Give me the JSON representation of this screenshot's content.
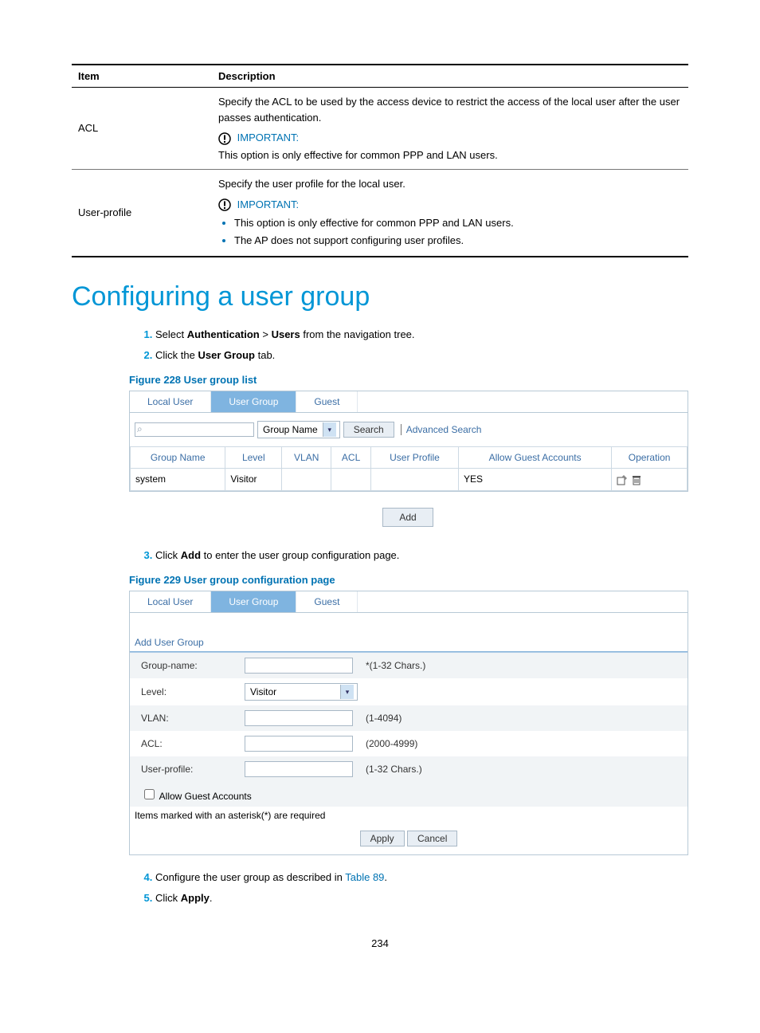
{
  "table": {
    "headers": {
      "item": "Item",
      "desc": "Description"
    },
    "row1": {
      "item": "ACL",
      "line1": "Specify the ACL to be used by the access device to restrict the access of the local user after the user passes authentication.",
      "important": "IMPORTANT:",
      "line2": "This option is only effective for common PPP and LAN users."
    },
    "row2": {
      "item": "User-profile",
      "line1": "Specify the user profile for the local user.",
      "important": "IMPORTANT:",
      "b1": "This option is only effective for common PPP and LAN users.",
      "b2": "The AP does not support configuring user profiles."
    }
  },
  "heading": "Configuring a user group",
  "steps": {
    "s1a": "Select ",
    "s1b": "Authentication",
    "s1c": " > ",
    "s1d": "Users",
    "s1e": " from the navigation tree.",
    "s2a": "Click the ",
    "s2b": "User Group",
    "s2c": " tab.",
    "s3a": "Click ",
    "s3b": "Add",
    "s3c": " to enter the user group configuration page.",
    "s4a": "Configure the user group as described in ",
    "s4link": "Table 89",
    "s4b": ".",
    "s5a": "Click ",
    "s5b": "Apply",
    "s5c": "."
  },
  "fig228": "Figure 228 User group list",
  "fig229": "Figure 229 User group configuration page",
  "tabs": {
    "local": "Local User",
    "group": "User Group",
    "guest": "Guest"
  },
  "search": {
    "field": "Group Name",
    "btn": "Search",
    "adv": "Advanced Search"
  },
  "grid": {
    "h1": "Group Name",
    "h2": "Level",
    "h3": "VLAN",
    "h4": "ACL",
    "h5": "User Profile",
    "h6": "Allow Guest Accounts",
    "h7": "Operation",
    "r1c1": "system",
    "r1c2": "Visitor",
    "r1c6": "YES"
  },
  "add_btn": "Add",
  "form": {
    "title": "Add User Group",
    "groupname": "Group-name:",
    "groupname_hint": "*(1-32 Chars.)",
    "level": "Level:",
    "level_value": "Visitor",
    "vlan": "VLAN:",
    "vlan_hint": "(1-4094)",
    "acl": "ACL:",
    "acl_hint": "(2000-4999)",
    "userprofile": "User-profile:",
    "userprofile_hint": "(1-32 Chars.)",
    "allow_guest": "Allow Guest Accounts",
    "req": "Items marked with an asterisk(*) are required",
    "apply": "Apply",
    "cancel": "Cancel"
  },
  "pagenum": "234"
}
